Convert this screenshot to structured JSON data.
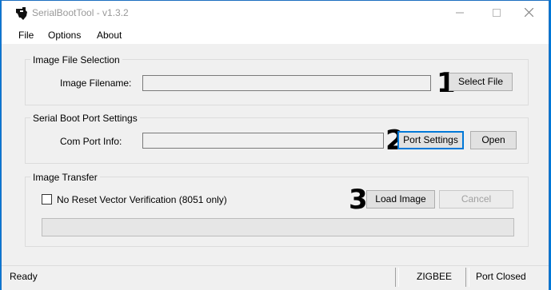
{
  "window": {
    "title": "SerialBootTool - v1.3.2"
  },
  "menu": {
    "items": [
      "File",
      "Options",
      "About"
    ]
  },
  "image_file_selection": {
    "title": "Image File Selection",
    "filename_label": "Image Filename:",
    "filename_value": "",
    "select_button": "Select File",
    "step": "1"
  },
  "serial_boot_port": {
    "title": "Serial Boot Port Settings",
    "port_label": "Com Port Info:",
    "port_value": "",
    "settings_button": "Port Settings",
    "open_button": "Open",
    "step": "2"
  },
  "image_transfer": {
    "title": "Image Transfer",
    "checkbox_label": "No Reset Vector Verification (8051 only)",
    "checkbox_checked": false,
    "load_button": "Load Image",
    "cancel_button": "Cancel",
    "step": "3",
    "progress": 0
  },
  "status": {
    "state": "Ready",
    "protocol": "ZIGBEE",
    "port": "Port Closed"
  },
  "colors": {
    "accent": "#0078d7",
    "window_bg": "#f0f0f0"
  }
}
